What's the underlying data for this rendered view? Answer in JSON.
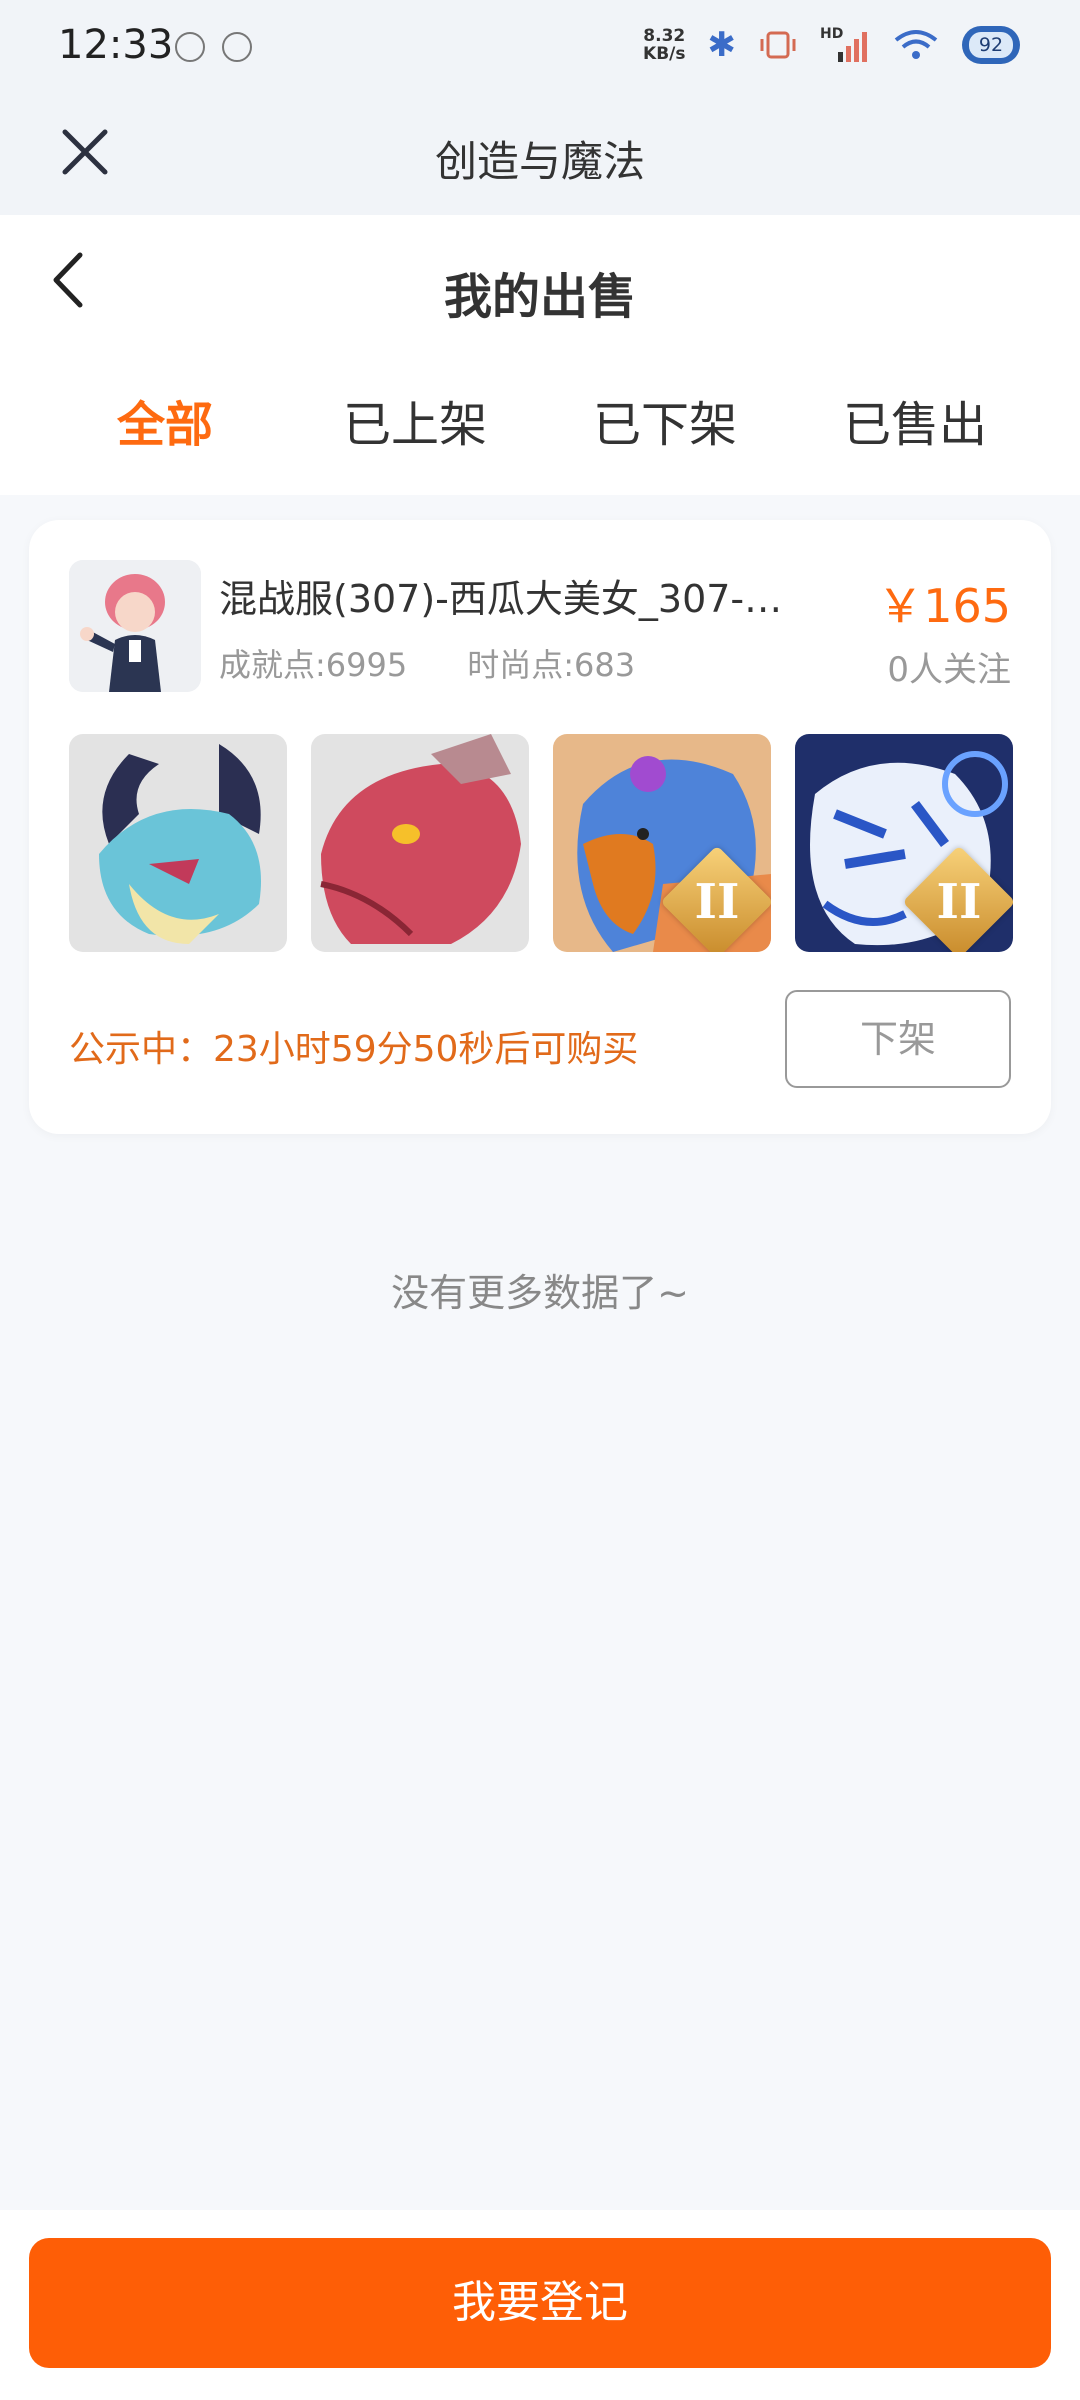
{
  "status_bar": {
    "time": "12:33",
    "net_speed_value": "8.32",
    "net_speed_unit": "KB/s",
    "battery": "92",
    "signal_label": "HD"
  },
  "app_header": {
    "title": "创造与魔法"
  },
  "page": {
    "title": "我的出售",
    "tabs": [
      {
        "label": "全部",
        "active": true
      },
      {
        "label": "已上架",
        "active": false
      },
      {
        "label": "已下架",
        "active": false
      },
      {
        "label": "已售出",
        "active": false
      }
    ]
  },
  "listing": {
    "title": "混战服(307)-西瓜大美女_307-…",
    "achievement": "成就点:6995",
    "fashion": "时尚点:683",
    "price": "￥165",
    "followers": "0人关注",
    "pets": [
      {
        "name": "dragon-blue",
        "badge": ""
      },
      {
        "name": "dragon-red",
        "badge": ""
      },
      {
        "name": "griffin",
        "badge": "II"
      },
      {
        "name": "tiger-white",
        "badge": "II"
      }
    ],
    "notice": "公示中：23小时59分50秒后可购买",
    "delist_label": "下架",
    "accent_color": "#fe6a10"
  },
  "footer_note": "没有更多数据了~",
  "bottom": {
    "register_label": "我要登记",
    "button_color": "#fe5e06"
  }
}
